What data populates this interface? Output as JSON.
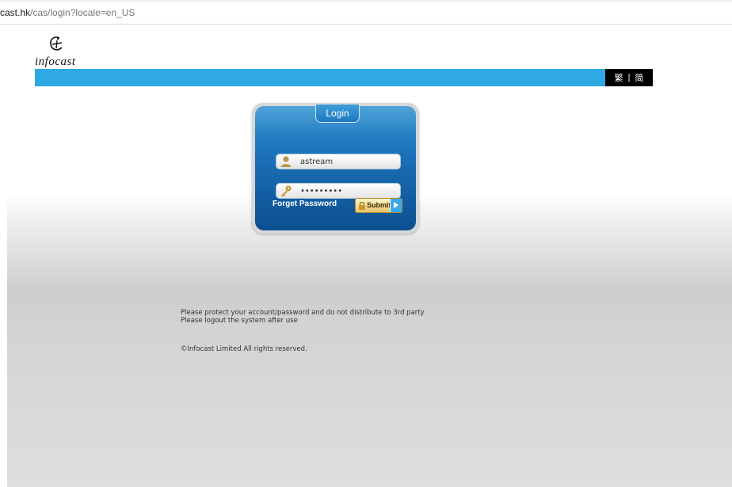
{
  "browser": {
    "url_host": "cast.hk",
    "url_path": "/cas/login?locale=en_US"
  },
  "header": {
    "logo_text": "infocast",
    "lang_traditional": "繁",
    "lang_separator": "|",
    "lang_simplified": "简",
    "banner_color": "#2fa9e3"
  },
  "login": {
    "tab_label": "Login",
    "username_value": "astream",
    "password_value": "•••••••••",
    "forget_password": "Forget Password",
    "submit_label": "Submit",
    "panel_color": "#1a6db4"
  },
  "footer": {
    "note1": "Please protect your account/password and do not distribute to 3rd party",
    "note2": "Please logout the system after use",
    "copyright": "©Infocast Limited All rights reserved."
  }
}
